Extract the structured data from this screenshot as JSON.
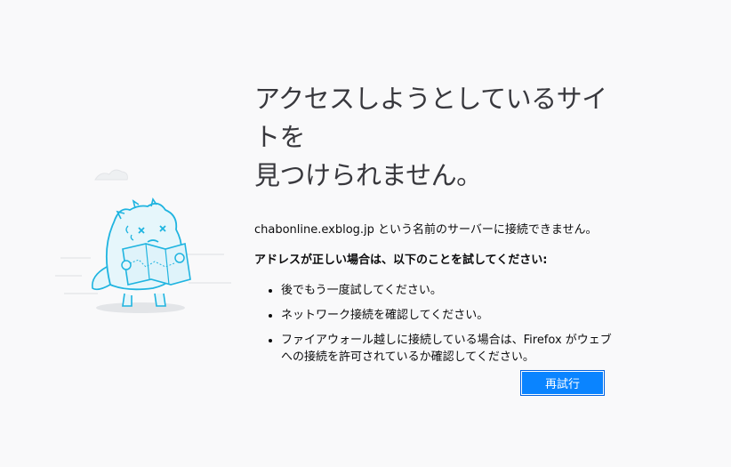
{
  "error": {
    "title_line1": "アクセスしようとしているサイトを",
    "title_line2": "見つけられません。",
    "description": "chabonline.exblog.jp という名前のサーバーに接続できません。",
    "advice_heading": "アドレスが正しい場合は、以下のことを試してください:",
    "advice_items": [
      "後でもう一度試してください。",
      "ネットワーク接続を確認してください。",
      "ファイアウォール越しに接続している場合は、Firefox がウェブへの接続を許可されているか確認してください。"
    ],
    "retry_label": "再試行"
  },
  "colors": {
    "accent": "#0a84ff",
    "background": "#f9f9fa",
    "illustration_stroke": "#1fb4e0",
    "illustration_fill": "#e6f6fb"
  },
  "icons": {
    "illustration": "confused-dinosaur-with-map-icon"
  }
}
